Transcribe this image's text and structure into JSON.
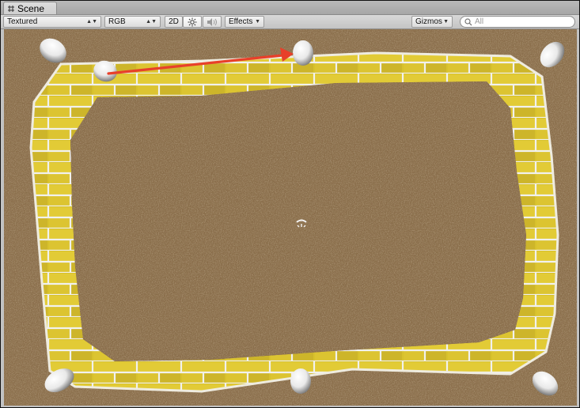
{
  "window": {
    "tab_title": "Scene",
    "tab_icon": "scene-grid-icon"
  },
  "toolbar": {
    "render_mode": "Textured",
    "color_mode": "RGB",
    "two_d_label": "2D",
    "lighting_icon": "sun-icon",
    "audio_icon": "speaker-icon",
    "effects_label": "Effects",
    "gizmos_label": "Gizmos",
    "search_placeholder": "All",
    "search_icon": "search-icon"
  },
  "scene": {
    "ground_color": "#8a6e4b",
    "brick_color": "#d9c22e",
    "arrow_color": "#e8402a",
    "objects": [
      "pebble-top-left",
      "pebble-top-mid",
      "pebble-top-right",
      "pebble-arrow-start",
      "pebble-bottom-left",
      "pebble-bottom-mid",
      "pebble-bottom-right"
    ],
    "center_gizmo": "light-gizmo-icon"
  }
}
